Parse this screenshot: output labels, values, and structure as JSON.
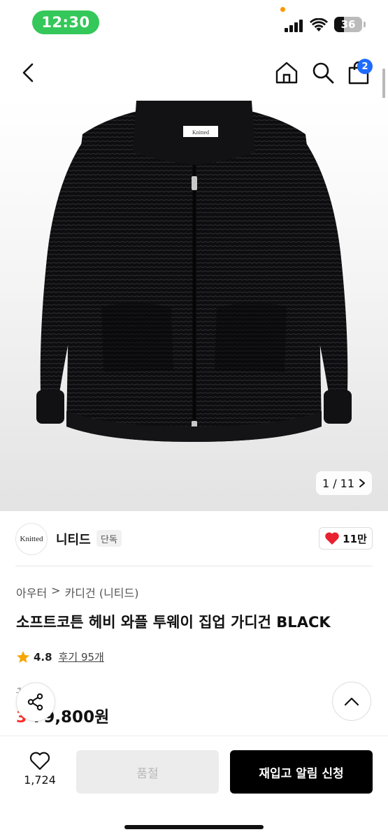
{
  "status_bar": {
    "time": "12:30",
    "battery": "36",
    "battery_level": 0.36
  },
  "header": {
    "cart_count": "2"
  },
  "product_image": {
    "counter_current": "1 / 11",
    "label_text": "Knitted"
  },
  "brand": {
    "logo_text": "Knitted",
    "name": "니티드",
    "tag": "단독",
    "likes": "11만"
  },
  "product": {
    "breadcrumb": [
      "아우터",
      ">",
      "카디건 (니티드)"
    ],
    "title": "소프트코튼 헤비 와플 투웨이 집업 가디건 BLACK",
    "rating": "4.8",
    "reviews": "후기 95개",
    "original_price": "1 0원",
    "discount": "3",
    "sale_price": "79,800원"
  },
  "bottom_bar": {
    "wish_count": "1,724",
    "soldout_label": "품절",
    "notify_label": "재입고 알림 신청"
  },
  "colors": {
    "accent_green": "#34c759",
    "badge_blue": "#1e6bff",
    "sale_red": "#ff2b2b",
    "heart_red": "#e8202f"
  }
}
